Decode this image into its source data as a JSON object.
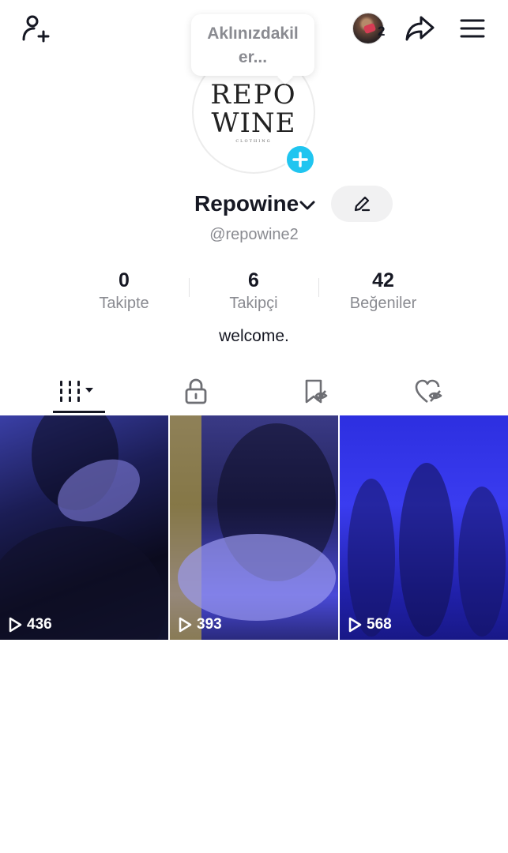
{
  "header": {
    "friends_count": "2",
    "tooltip_text": "Aklınızdakil er..."
  },
  "profile": {
    "avatar_logo_line1": "REPO",
    "avatar_logo_line2": "WINE",
    "avatar_logo_line3": "CLOTHING",
    "display_name": "Repowine",
    "username": "@repowine2",
    "bio": "welcome."
  },
  "stats": [
    {
      "value": "0",
      "label": "Takipte"
    },
    {
      "value": "6",
      "label": "Takipçi"
    },
    {
      "value": "42",
      "label": "Beğeniler"
    }
  ],
  "tabs": [
    {
      "icon": "videos-grid-icon",
      "active": true
    },
    {
      "icon": "lock-icon",
      "active": false
    },
    {
      "icon": "saved-bookmark-icon",
      "active": false
    },
    {
      "icon": "liked-heart-icon",
      "active": false
    }
  ],
  "videos": [
    {
      "views": "436"
    },
    {
      "views": "393"
    },
    {
      "views": "568"
    }
  ],
  "colors": {
    "accent": "#20c5f0",
    "text_primary": "#161823",
    "text_secondary": "#8a8b91"
  }
}
